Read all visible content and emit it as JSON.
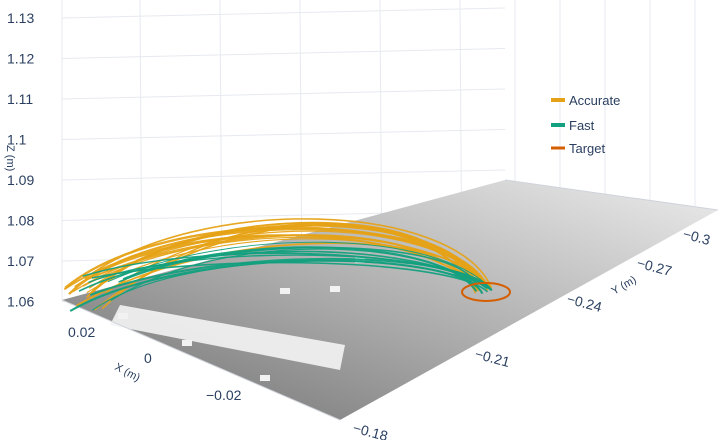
{
  "chart_data": {
    "type": "line",
    "subtype": "3d-trajectories",
    "title": "",
    "axes": {
      "x": {
        "label": "X (m)",
        "ticks": [
          "0.02",
          "0",
          "−0.02"
        ],
        "range": [
          0.03,
          -0.04
        ]
      },
      "y": {
        "label": "Y (m)",
        "ticks": [
          "−0.18",
          "−0.21",
          "−0.24",
          "−0.27",
          "−0.3"
        ],
        "range": [
          -0.18,
          -0.31
        ]
      },
      "z": {
        "label": "Z (m)",
        "ticks": [
          "1.06",
          "1.07",
          "1.08",
          "1.09",
          "1.1",
          "1.11",
          "1.12",
          "1.13"
        ],
        "range": [
          1.055,
          1.135
        ]
      }
    },
    "grid": true,
    "legend_position": "right",
    "series": [
      {
        "name": "Accurate",
        "color": "#e6a216",
        "shape": "trajectory-bundle",
        "count": 16,
        "apex_z_approx": 1.08
      },
      {
        "name": "Fast",
        "color": "#12a07e",
        "shape": "trajectory-bundle",
        "count": 11,
        "apex_z_approx": 1.075
      },
      {
        "name": "Target",
        "color": "#d55e00",
        "shape": "circle",
        "center_y_approx": -0.245,
        "center_z": 1.06
      }
    ]
  },
  "legend": {
    "accurate": {
      "label": "Accurate",
      "color": "#e6a216"
    },
    "fast": {
      "label": "Fast",
      "color": "#12a07e"
    },
    "target": {
      "label": "Target",
      "color": "#d55e00"
    }
  }
}
